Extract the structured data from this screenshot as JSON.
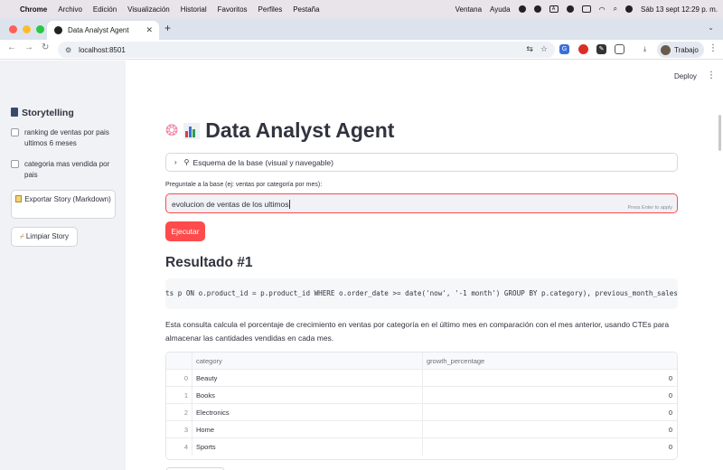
{
  "menubar": {
    "items": [
      "Chrome",
      "Archivo",
      "Edición",
      "Visualización",
      "Historial",
      "Favoritos",
      "Perfiles",
      "Pestaña"
    ],
    "right_items": [
      "Ventana",
      "Ayuda"
    ],
    "clock": "Sáb 13 sept  12:29 p. m."
  },
  "browser": {
    "tab_title": "Data Analyst Agent",
    "url": "localhost:8501",
    "profile_name": "Trabajo"
  },
  "sidebar": {
    "title": "Storytelling",
    "title_icon": "thread-spool-icon",
    "items": [
      {
        "label": "ranking de ventas por pais ultimos 6 meses",
        "checked": false
      },
      {
        "label": "categoria mas vendida por pais",
        "checked": false
      }
    ],
    "export_button": "Exportar Story (Markdown)",
    "clear_button": "Limpiar Story"
  },
  "header": {
    "deploy_label": "Deploy"
  },
  "main": {
    "title": "Data Analyst Agent",
    "title_icons": [
      "brain-icon",
      "bar-chart-icon"
    ],
    "expander_label": "Esquema de la base (visual y navegable)",
    "query_label": "Preguntale a la base (ej: ventas por categoría por mes):",
    "query_value": "evolucion de ventas de los ultimos",
    "query_hint": "Press Enter to apply",
    "run_button": "Ejecutar",
    "result_heading": "Resultado #1",
    "sql_snippet": "ts p ON o.product_id = p.product_id WHERE o.order_date >= date('now', '-1 month') GROUP BY p.category), previous_month_sales",
    "description": "Esta consulta calcula el porcentaje de crecimiento en ventas por categoría en el último mes en comparación con el mes anterior, usando CTEs para almacenar las cantidades vendidas en cada mes.",
    "table": {
      "columns": [
        "category",
        "growth_percentage"
      ],
      "rows": [
        {
          "index": "0",
          "category": "Beauty",
          "growth_percentage": "0"
        },
        {
          "index": "1",
          "category": "Books",
          "growth_percentage": "0"
        },
        {
          "index": "2",
          "category": "Electronics",
          "growth_percentage": "0"
        },
        {
          "index": "3",
          "category": "Home",
          "growth_percentage": "0"
        },
        {
          "index": "4",
          "category": "Sports",
          "growth_percentage": "0"
        }
      ]
    }
  },
  "colors": {
    "accent": "#ff4b4b",
    "sidebar_bg": "#f0f2f6",
    "text": "#31333f"
  }
}
